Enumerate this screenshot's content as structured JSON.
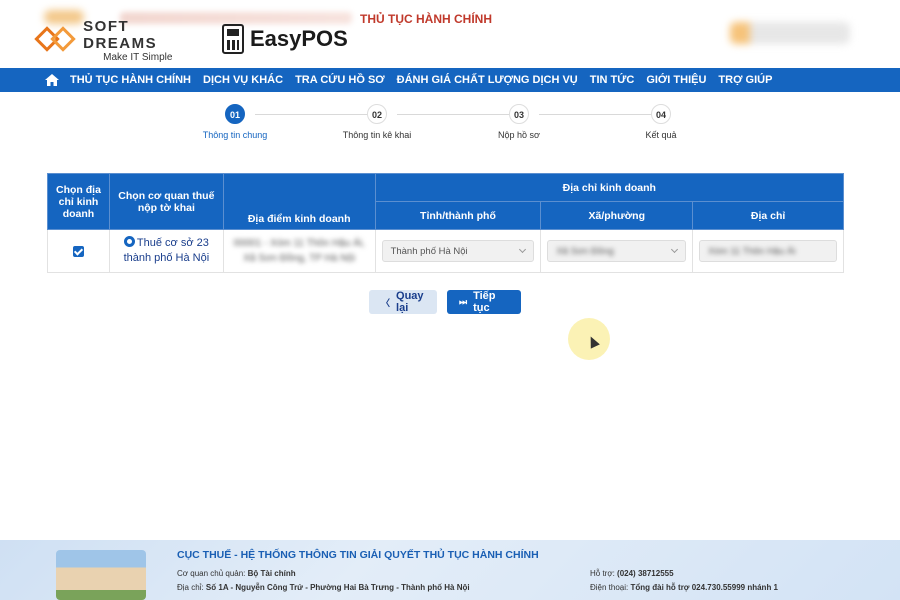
{
  "header": {
    "brand_name": "SOFT DREAMS",
    "brand_tagline": "Make IT Simple",
    "pos_name": "EasyPOS",
    "site_title": "THỦ TỤC HÀNH CHÍNH"
  },
  "nav": {
    "items": [
      "THỦ TỤC HÀNH CHÍNH",
      "DỊCH VỤ KHÁC",
      "TRA CỨU HỒ SƠ",
      "ĐÁNH GIÁ CHẤT LƯỢNG DỊCH VỤ",
      "TIN TỨC",
      "GIỚI THIỆU",
      "TRỢ GIÚP"
    ]
  },
  "stepper": {
    "steps": [
      {
        "num": "01",
        "label": "Thông tin chung",
        "active": true
      },
      {
        "num": "02",
        "label": "Thông tin kê khai",
        "active": false
      },
      {
        "num": "03",
        "label": "Nộp hồ sơ",
        "active": false
      },
      {
        "num": "04",
        "label": "Kết quả",
        "active": false
      }
    ]
  },
  "table": {
    "headers": {
      "choose_address": "Chọn địa chỉ kinh doanh",
      "choose_tax_office": "Chọn cơ quan thuế nộp tờ khai",
      "location": "Địa điểm kinh doanh",
      "business_address": "Địa chỉ kinh doanh",
      "province": "Tỉnh/thành phố",
      "ward": "Xã/phường",
      "address": "Địa chỉ"
    },
    "row": {
      "tax_office": "Thuế cơ sở 23 thành phố Hà Nội",
      "location_text": "00001 - Xóm 11 Thôn Hậu Ái, Xã Sơn Đồng, TP Hà Nội",
      "province_value": "Thành phố Hà Nội",
      "ward_value": "Xã Sơn Đồng",
      "address_value": "Xóm 11 Thôn Hậu Ái"
    }
  },
  "buttons": {
    "back": "Quay lại",
    "next": "Tiếp tục"
  },
  "footer": {
    "title": "CỤC THUẾ - HỆ THỐNG THÔNG TIN GIẢI QUYẾT THỦ TỤC HÀNH CHÍNH",
    "agency_label": "Cơ quan chủ quản:",
    "agency_value": "Bộ Tài chính",
    "address_label": "Địa chỉ:",
    "address_value": "Số 1A - Nguyễn Công Trứ - Phường Hai Bà Trưng - Thành phố Hà Nội",
    "support_label": "Hỗ trợ:",
    "support_value": "(024) 38712555",
    "phone_label": "Điện thoại:",
    "phone_value": "Tổng đài hỗ trợ 024.730.55999 nhánh 1"
  },
  "colors": {
    "primary": "#1565c0",
    "site_title": "#c0392b"
  }
}
